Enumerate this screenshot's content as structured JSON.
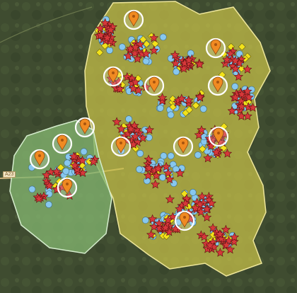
{
  "map": {
    "road_label": "A23",
    "legend_colors": {
      "park_yellow_zone": "#c9c24a",
      "park_green_zone": "#83b56f",
      "star_marker": "#d6383a",
      "circle_marker": "#87c7ee",
      "diamond_marker": "#f2e21a",
      "pin_marker": "#f08a22",
      "pin_halo": "#ffffff"
    },
    "marker_kinds": [
      "red-star",
      "blue-circle",
      "yellow-diamond",
      "orange-pin-with-halo"
    ],
    "pin_count": 13
  }
}
